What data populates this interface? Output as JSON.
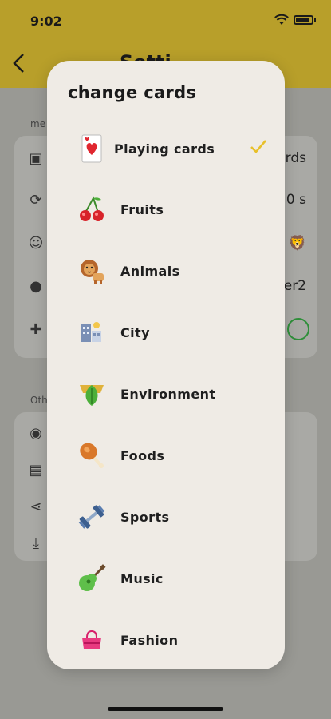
{
  "status": {
    "time": "9:02"
  },
  "header": {
    "title": "Setti"
  },
  "background": {
    "section1_label": "me",
    "section2_label": "Oth",
    "rows1": [
      {
        "icon": "image-icon",
        "value": "rds"
      },
      {
        "icon": "refresh-icon",
        "value": "0 s"
      },
      {
        "icon": "face-icon",
        "value": ""
      },
      {
        "icon": "person-icon",
        "value": "er2"
      },
      {
        "icon": "add-person-icon",
        "value": ""
      },
      {
        "icon": "navigation-icon",
        "value": ""
      }
    ],
    "rows2": [
      {
        "icon": "privacy-icon"
      },
      {
        "icon": "document-icon"
      },
      {
        "icon": "share-icon"
      },
      {
        "icon": "download-icon"
      }
    ]
  },
  "modal": {
    "title": "change cards",
    "selected_index": 0,
    "accent": "#e8c02a",
    "options": [
      {
        "label": "Playing cards",
        "icon": "playing-card-icon"
      },
      {
        "label": "Fruits",
        "icon": "cherries-icon"
      },
      {
        "label": "Animals",
        "icon": "lion-icon"
      },
      {
        "label": "City",
        "icon": "city-icon"
      },
      {
        "label": "Environment",
        "icon": "leaf-icon"
      },
      {
        "label": "Foods",
        "icon": "drumstick-icon"
      },
      {
        "label": "Sports",
        "icon": "dumbbell-icon"
      },
      {
        "label": "Music",
        "icon": "guitar-icon"
      },
      {
        "label": "Fashion",
        "icon": "handbag-icon"
      }
    ]
  }
}
